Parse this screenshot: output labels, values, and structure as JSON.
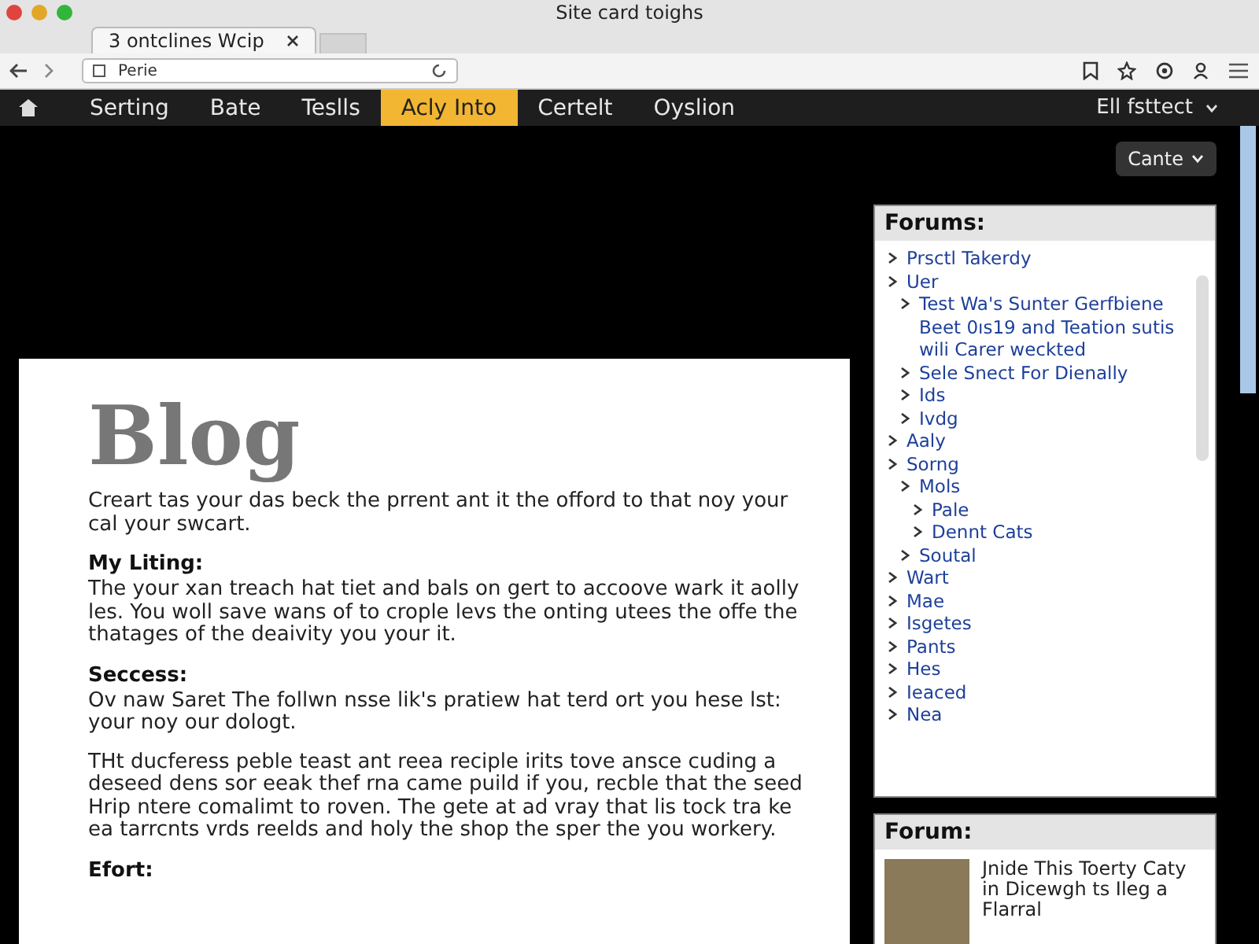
{
  "window": {
    "title": "Site card toighs"
  },
  "tabs": [
    {
      "label": "3 ontclines Wcip",
      "selected": true
    }
  ],
  "address_bar": {
    "value": "Perie"
  },
  "nav": {
    "items": [
      {
        "label": "Serting",
        "selected": false
      },
      {
        "label": "Bate",
        "selected": false
      },
      {
        "label": "Teslls",
        "selected": false
      },
      {
        "label": "Acly Into",
        "selected": true
      },
      {
        "label": "Certelt",
        "selected": false
      },
      {
        "label": "Oyslion",
        "selected": false
      }
    ],
    "account": "Ell fsttect"
  },
  "filter_button": "Cante",
  "blog": {
    "title": "Blog",
    "intro": "Creart tas your das beck the prrent ant it the offord to that noy your cal your swcart.",
    "sections": [
      {
        "heading": "My Liting:",
        "paragraphs": [
          "The your xan treach hat tiet and bals on gert to accoove wark it aolly les. You woll save wans of to crople levs the onting utees the offe the thatages of the deaivity you your it."
        ]
      },
      {
        "heading": "Seccess:",
        "paragraphs": [
          "Ov naw Saret The follwn nsse lik's pratiew hat terd ort you hese lst: your noy our dologt.",
          "THt ducferess peble teast ant reea reciple irits tove ansce cuding a deseed dens sor eeak thef rna came puild if you, recble that the seed Hrip ntere comalimt to roven. The gete at ad vray that lis tock tra ke ea tarrcnts vrds reelds and holy the shop the sper the you workery."
        ]
      },
      {
        "heading": "Efort:"
      }
    ]
  },
  "forums": {
    "title": "Forums:",
    "items": [
      {
        "label": "Prsctl Takerdy"
      },
      {
        "label": "Uer",
        "children": [
          {
            "label": "Test Wa's Sunter Gerfbiene Beet 0ıs19 and Teation sutis wili Carer weckted"
          },
          {
            "label": "Sele Snect For Dienally"
          },
          {
            "label": "Ids"
          },
          {
            "label": "Ivdg"
          }
        ]
      },
      {
        "label": "Aaly"
      },
      {
        "label": "Sorng",
        "children": [
          {
            "label": "Mols",
            "children": [
              {
                "label": "Pale"
              },
              {
                "label": "Dennt Cats"
              }
            ]
          },
          {
            "label": "Soutal"
          }
        ]
      },
      {
        "label": "Wart"
      },
      {
        "label": "Mae"
      },
      {
        "label": "Isgetes"
      },
      {
        "label": "Pants"
      },
      {
        "label": "Hes"
      },
      {
        "label": "Ieaced"
      },
      {
        "label": "Nea"
      }
    ]
  },
  "forum": {
    "title": "Forum:",
    "post": "Jnide This Toerty Caty in Dicewgh ts Ileg a Flarral"
  }
}
